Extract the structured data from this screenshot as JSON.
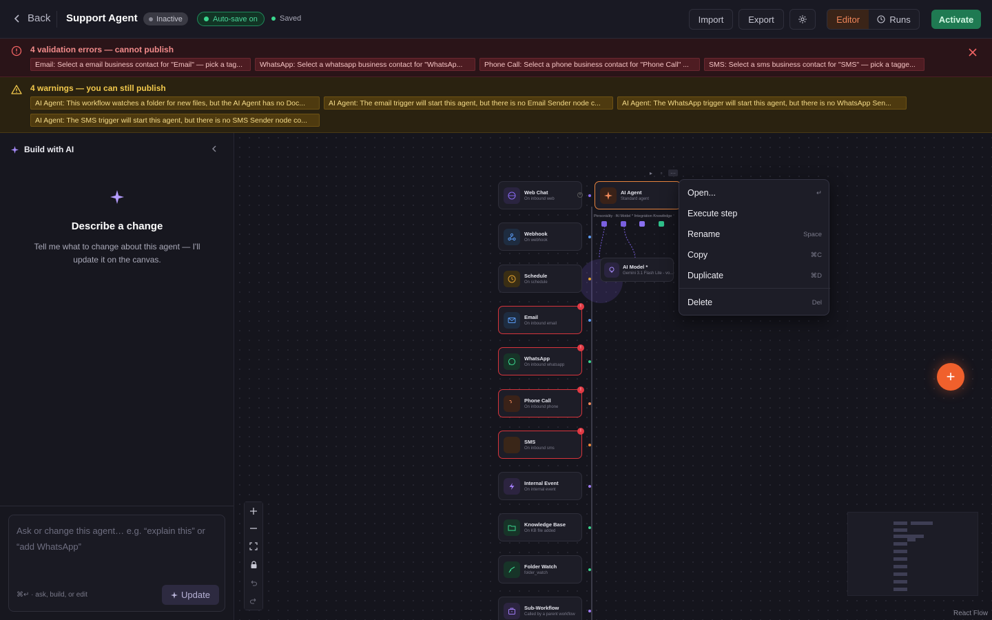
{
  "header": {
    "back_label": "Back",
    "title": "Support Agent",
    "status_badge": "Inactive",
    "autosave_badge": "Auto-save on",
    "saved_label": "Saved",
    "import_label": "Import",
    "export_label": "Export",
    "editor_tab": "Editor",
    "runs_tab": "Runs",
    "activate_label": "Activate"
  },
  "errors": {
    "title": "4 validation errors — cannot publish",
    "items": [
      "Email: Select a email business contact for \"Email\" — pick a tag...",
      "WhatsApp: Select a whatsapp business contact for \"WhatsAp...",
      "Phone Call: Select a phone business contact for \"Phone Call\" ...",
      "SMS: Select a sms business contact for \"SMS\" — pick a tagge..."
    ]
  },
  "warnings": {
    "title": "4 warnings — you can still publish",
    "items": [
      "AI Agent: This workflow watches a folder for new files, but the AI Agent has no Doc...",
      "AI Agent: The email trigger will start this agent, but there is no Email Sender node c...",
      "AI Agent: The WhatsApp trigger will start this agent, but there is no WhatsApp Sen...",
      "AI Agent: The SMS trigger will start this agent, but there is no SMS Sender node co..."
    ]
  },
  "sidebar": {
    "title": "Build with AI",
    "heading": "Describe a change",
    "description": "Tell me what to change about this agent — I'll update it on the canvas.",
    "input_placeholder": "Ask or change this agent… e.g. “explain this” or “add WhatsApp”",
    "hint": "⌘↵ · ask, build, or edit",
    "update_label": "Update"
  },
  "nodes": [
    {
      "title": "Web Chat",
      "sub": "On inbound web",
      "color": "#8b6cf6",
      "bg": "#2a2440",
      "icon": "globe-icon",
      "error": false
    },
    {
      "title": "Webhook",
      "sub": "On webhook",
      "color": "#5b9cf6",
      "bg": "#1e2c40",
      "icon": "webhook-icon",
      "error": false
    },
    {
      "title": "Schedule",
      "sub": "On schedule",
      "color": "#e0a030",
      "bg": "#3a2e14",
      "icon": "clock-icon",
      "error": false
    },
    {
      "title": "Email",
      "sub": "On inbound email",
      "color": "#5b9cf6",
      "bg": "#1e2c40",
      "icon": "mail-icon",
      "error": true
    },
    {
      "title": "WhatsApp",
      "sub": "On inbound whatsapp",
      "color": "#3ad68e",
      "bg": "#173428",
      "icon": "whatsapp-icon",
      "error": true
    },
    {
      "title": "Phone Call",
      "sub": "On inbound phone",
      "color": "#f08a5a",
      "bg": "#3a2218",
      "icon": "phone-icon",
      "error": true
    },
    {
      "title": "SMS",
      "sub": "On inbound sms",
      "color": "#f08a3a",
      "bg": "#3a2618",
      "icon": "chat-icon",
      "error": true
    },
    {
      "title": "Internal Event",
      "sub": "On internal event",
      "color": "#a07cf6",
      "bg": "#2c2440",
      "icon": "bolt-icon",
      "error": false
    },
    {
      "title": "Knowledge Base",
      "sub": "On KB file added",
      "color": "#3ad68e",
      "bg": "#173428",
      "icon": "folder-icon",
      "error": false
    },
    {
      "title": "Folder Watch",
      "sub": "folder_watch",
      "color": "#3ad68e",
      "bg": "#173428",
      "icon": "folder-watch-icon",
      "error": false
    },
    {
      "title": "Sub-Workflow",
      "sub": "Called by a parent workflow",
      "color": "#a07cf6",
      "bg": "#2c2440",
      "icon": "briefcase-icon",
      "error": false
    }
  ],
  "agent_node": {
    "title": "AI Agent",
    "sub": "Standard agent",
    "ports_label": "Personality · AI Model * Integration Knowledge"
  },
  "model_node": {
    "title": "AI Model *",
    "sub": "Gemini 3.1 Flash Lite - vo..."
  },
  "context_menu": {
    "items": [
      {
        "label": "Open...",
        "shortcut": "↵"
      },
      {
        "label": "Execute step",
        "shortcut": ""
      },
      {
        "label": "Rename",
        "shortcut": "Space"
      },
      {
        "label": "Copy",
        "shortcut": "⌘C"
      },
      {
        "label": "Duplicate",
        "shortcut": "⌘D"
      },
      {
        "label": "Delete",
        "shortcut": "Del"
      }
    ]
  },
  "attribution": "React Flow"
}
